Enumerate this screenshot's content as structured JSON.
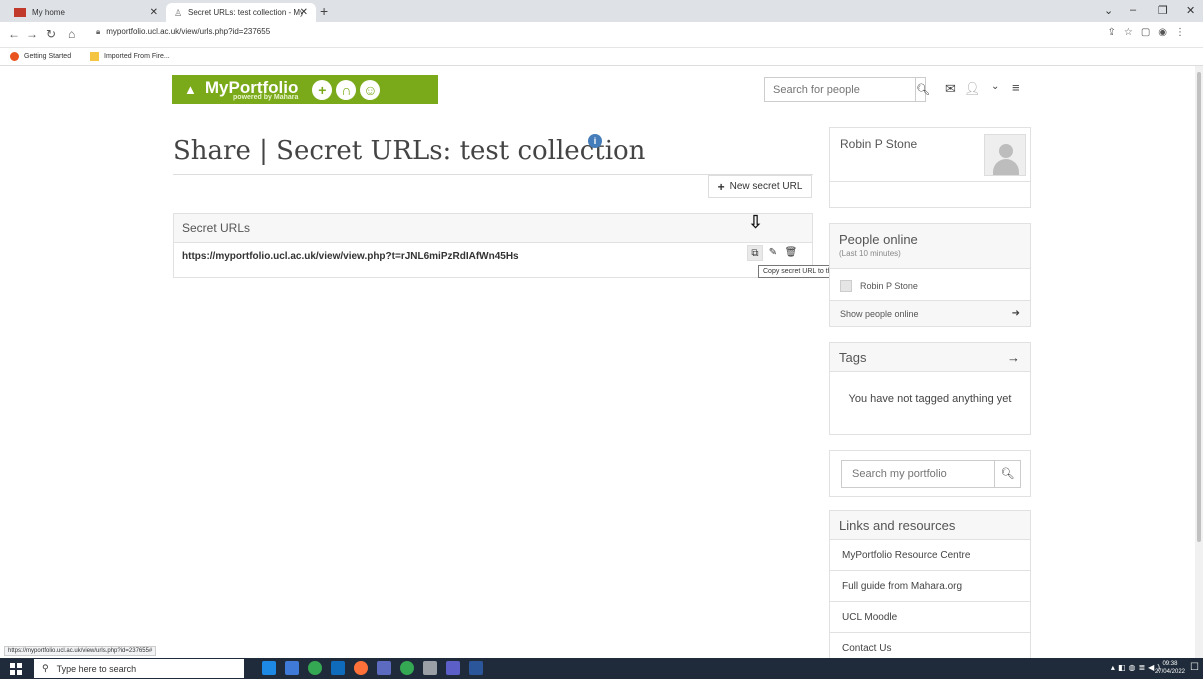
{
  "browser": {
    "tabs": [
      {
        "title": "My home",
        "active": false
      },
      {
        "title": "Secret URLs: test collection - My",
        "active": true
      }
    ],
    "new_tab": "+",
    "url": "myportfolio.ucl.ac.uk/view/urls.php?id=237655",
    "bookmarks": [
      "Getting Started",
      "Imported From Fire..."
    ],
    "status_url": "https://myportfolio.ucl.ac.uk/view/urls.php?id=237655#"
  },
  "header": {
    "brand": "MyPortfolio",
    "brand_sub": "powered by Mahara",
    "search_placeholder": "Search for people"
  },
  "main": {
    "title": "Share | Secret URLs: test collection",
    "info_glyph": "i",
    "new_button": "New secret URL",
    "panel_title": "Secret URLs",
    "secret_url": "https://myportfolio.ucl.ac.uk/view/view.php?t=rJNL6miPzRdIAfWn45Hs",
    "tooltip": "Copy secret URL to the clipboard"
  },
  "sidebar": {
    "profile_name": "Robin P Stone",
    "online_title": "People online",
    "online_sub": "(Last 10 minutes)",
    "online_person": "Robin P Stone",
    "online_footer": "Show people online",
    "tags_title": "Tags",
    "tags_empty": "You have not tagged anything yet",
    "search_placeholder": "Search my portfolio",
    "links_title": "Links and resources",
    "links": [
      "MyPortfolio Resource Centre",
      "Full guide from Mahara.org",
      "UCL Moodle",
      "Contact Us"
    ]
  },
  "taskbar": {
    "search_placeholder": "Type here to search",
    "time": "09:38",
    "date": "27/04/2022"
  },
  "colors": {
    "brand_green": "#7aaa1a",
    "info_blue": "#457cba",
    "taskbar": "#1f2b3a"
  }
}
